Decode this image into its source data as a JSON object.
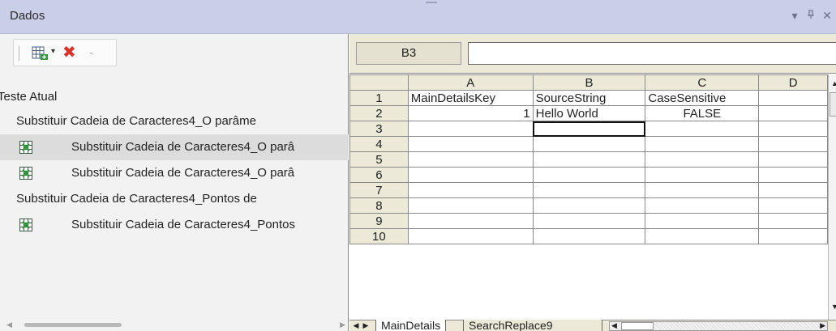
{
  "panel": {
    "title": "Dados",
    "pin_glyph": "↑",
    "close_glyph": "✕",
    "menu_glyph": "▾"
  },
  "toolbar": {
    "add_icon": "add-table-icon",
    "delete_icon": "delete-x-icon",
    "more_glyph": "⌄",
    "delete_glyph": "✖",
    "dropdown_glyph": "▾"
  },
  "tree": {
    "root": "Teste Atual",
    "items": [
      {
        "label": "Substituir Cadeia de Caracteres4_O parâme",
        "has_icon": false
      },
      {
        "label": "Substituir Cadeia de Caracteres4_O parâ",
        "has_icon": true,
        "selected": true
      },
      {
        "label": "Substituir Cadeia de Caracteres4_O parâ",
        "has_icon": true
      },
      {
        "label": "Substituir Cadeia de Caracteres4_Pontos de",
        "has_icon": false
      },
      {
        "label": "Substituir Cadeia de Caracteres4_Pontos",
        "has_icon": true
      }
    ]
  },
  "formula_bar": {
    "name_box": "B3",
    "formula": ""
  },
  "sheet": {
    "columns": [
      "A",
      "B",
      "C",
      "D"
    ],
    "rows": [
      {
        "n": "1",
        "cells": [
          "MainDetailsKey",
          "SourceString",
          "CaseSensitive",
          ""
        ]
      },
      {
        "n": "2",
        "cells": [
          "1",
          "Hello World",
          "FALSE",
          ""
        ]
      },
      {
        "n": "3",
        "cells": [
          "",
          "",
          "",
          ""
        ]
      },
      {
        "n": "4",
        "cells": [
          "",
          "",
          "",
          ""
        ]
      },
      {
        "n": "5",
        "cells": [
          "",
          "",
          "",
          ""
        ]
      },
      {
        "n": "6",
        "cells": [
          "",
          "",
          "",
          ""
        ]
      },
      {
        "n": "7",
        "cells": [
          "",
          "",
          "",
          ""
        ]
      },
      {
        "n": "8",
        "cells": [
          "",
          "",
          "",
          ""
        ]
      },
      {
        "n": "9",
        "cells": [
          "",
          "",
          "",
          ""
        ]
      },
      {
        "n": "10",
        "cells": [
          "",
          "",
          "",
          ""
        ]
      }
    ],
    "active_cell": "B3",
    "tabs": [
      "MainDetails",
      "SearchReplace9"
    ]
  }
}
